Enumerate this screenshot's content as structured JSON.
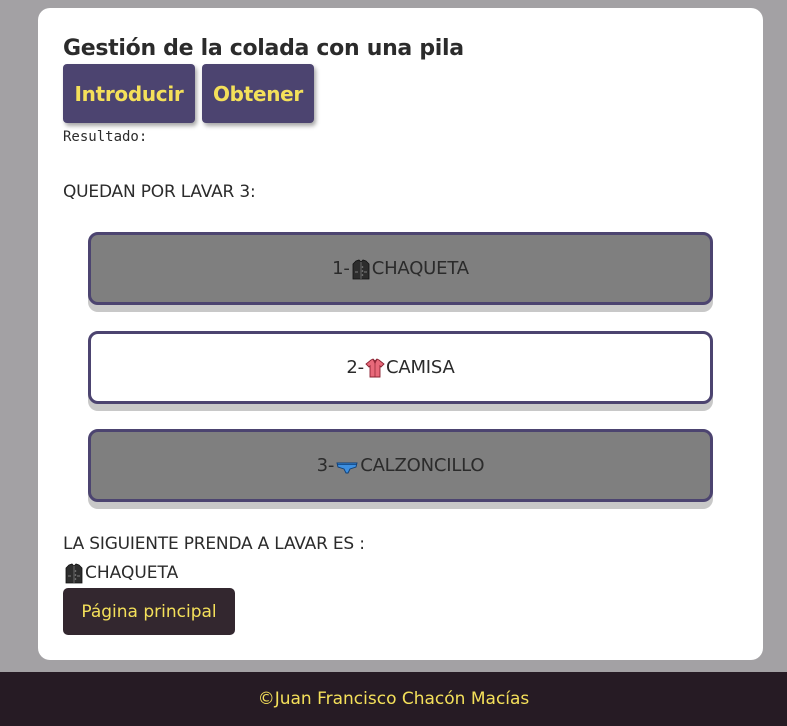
{
  "title": "Gestión de la colada con una pila",
  "buttons": {
    "push": "Introducir",
    "pop": "Obtener"
  },
  "result_label": "Resultado:",
  "remaining_label": "QUEDAN POR LAVAR 3:",
  "stack": [
    {
      "prefix": "1-",
      "icon": "jacket-icon",
      "name": "CHAQUETA",
      "color": "#7f7f7f"
    },
    {
      "prefix": "2-",
      "icon": "shirt-icon",
      "name": "CAMISA",
      "color": "#ffffff"
    },
    {
      "prefix": "3-",
      "icon": "briefs-icon",
      "name": "CALZONCILLO",
      "color": "#7f7f7f"
    }
  ],
  "next_label": "LA SIGUIENTE PRENDA A LAVAR ES :",
  "next_item": {
    "icon": "jacket-icon",
    "name": "CHAQUETA"
  },
  "home_button": "Página principal",
  "footer": "©Juan Francisco Chacón Macías",
  "colors": {
    "accent": "#4c4470",
    "highlight": "#f4e05a",
    "footer_bg": "#261b24"
  }
}
